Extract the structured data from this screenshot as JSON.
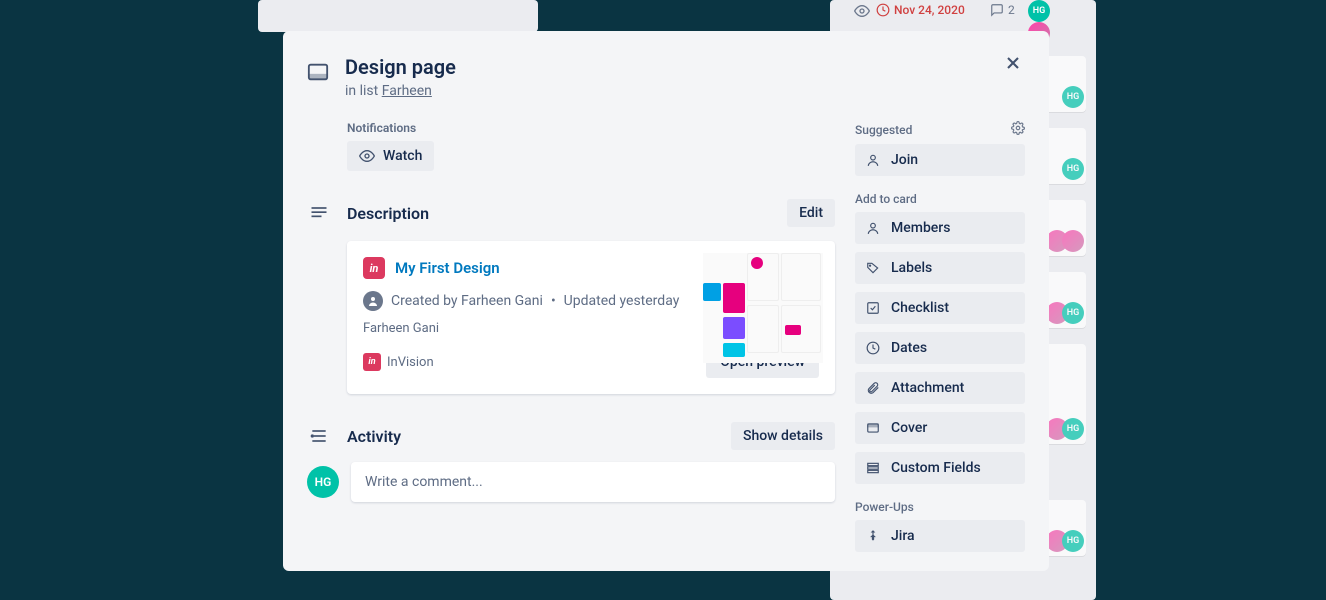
{
  "bg": {
    "due": "Nov 24, 2020",
    "comments": "2",
    "initials": "HG"
  },
  "modal": {
    "title": "Design page",
    "in_list_prefix": "in list ",
    "in_list_name": "Farheen",
    "notifications_label": "Notifications",
    "watch_label": "Watch",
    "description_label": "Description",
    "edit_label": "Edit",
    "invision_card": {
      "title": "My First Design",
      "meta_created": "Created by Farheen Gani",
      "meta_dot": "•",
      "meta_updated": "Updated yesterday",
      "author": "Farheen Gani",
      "brand": "InVision",
      "open_preview": "Open preview"
    },
    "activity_label": "Activity",
    "show_details": "Show details",
    "avatar_initials": "HG",
    "comment_placeholder": "Write a comment..."
  },
  "sidebar": {
    "suggested_label": "Suggested",
    "join_label": "Join",
    "add_to_card_label": "Add to card",
    "members_label": "Members",
    "labels_label": "Labels",
    "checklist_label": "Checklist",
    "dates_label": "Dates",
    "attachment_label": "Attachment",
    "cover_label": "Cover",
    "custom_fields_label": "Custom Fields",
    "powerups_label": "Power-Ups",
    "jira_label": "Jira"
  }
}
